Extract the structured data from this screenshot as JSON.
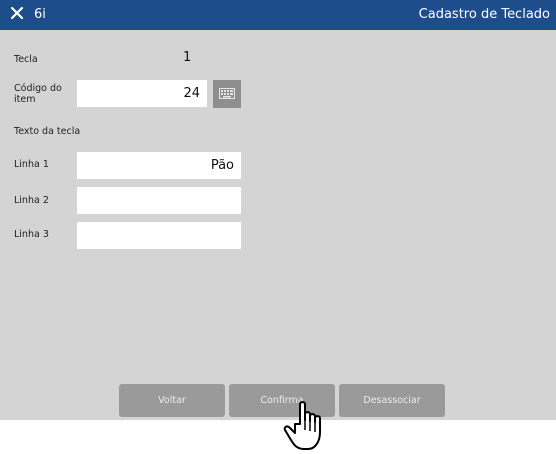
{
  "titlebar": {
    "app_code": "6i",
    "title": "Cadastro de Teclado"
  },
  "form": {
    "tecla_label": "Tecla",
    "tecla_value": "1",
    "codigo_label_line1": "Código do",
    "codigo_label_line2": "item",
    "codigo_value": "24",
    "texto_label": "Texto da tecla",
    "linha1_label": "Linha 1",
    "linha1_value": "Pão",
    "linha2_label": "Linha 2",
    "linha2_value": "",
    "linha3_label": "Linha 3",
    "linha3_value": ""
  },
  "buttons": {
    "voltar": "Voltar",
    "confirma": "Confirma",
    "desassociar": "Desassociar"
  },
  "icons": {
    "close": "close-icon",
    "keyboard": "keyboard-icon",
    "cursor": "hand-pointer-icon"
  },
  "colors": {
    "titlebar": "#1e4d8c",
    "panel": "#d4d4d4",
    "button": "#9a9a9a"
  }
}
